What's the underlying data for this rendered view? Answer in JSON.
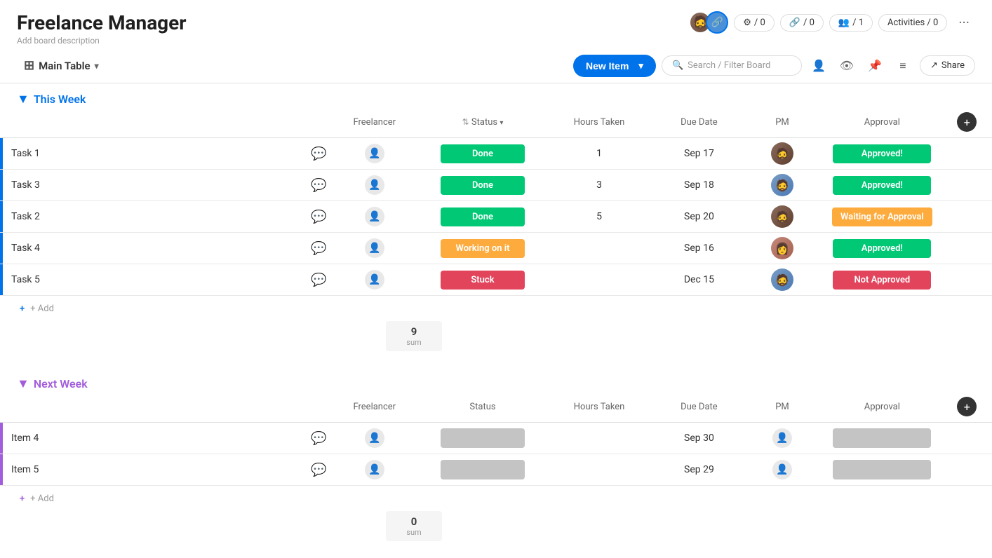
{
  "app": {
    "title": "Freelance Manager",
    "description": "Add board description"
  },
  "header": {
    "activities_label": "Activities / 0",
    "members_label": "/ 1",
    "automation_label": "/ 0",
    "integrations_label": "/ 0"
  },
  "toolbar": {
    "main_table_label": "Main Table",
    "new_item_label": "New Item",
    "search_placeholder": "Search / Filter Board",
    "share_label": "Share"
  },
  "groups": [
    {
      "id": "this-week",
      "title": "This Week",
      "color": "blue",
      "columns": {
        "freelancer": "Freelancer",
        "status": "Status",
        "hours": "Hours Taken",
        "due_date": "Due Date",
        "pm": "PM",
        "approval": "Approval"
      },
      "rows": [
        {
          "id": 1,
          "task": "Task 1",
          "status": "Done",
          "status_type": "done",
          "hours": "1",
          "due_date": "Sep 17",
          "approval": "Approved!",
          "approval_type": "approved"
        },
        {
          "id": 2,
          "task": "Task 3",
          "status": "Done",
          "status_type": "done",
          "hours": "3",
          "due_date": "Sep 18",
          "approval": "Approved!",
          "approval_type": "approved"
        },
        {
          "id": 3,
          "task": "Task 2",
          "status": "Done",
          "status_type": "done",
          "hours": "5",
          "due_date": "Sep 20",
          "approval": "Waiting for Approval",
          "approval_type": "waiting"
        },
        {
          "id": 4,
          "task": "Task 4",
          "status": "Working on it",
          "status_type": "working",
          "hours": "",
          "due_date": "Sep 16",
          "approval": "Approved!",
          "approval_type": "approved"
        },
        {
          "id": 5,
          "task": "Task 5",
          "status": "Stuck",
          "status_type": "stuck",
          "hours": "",
          "due_date": "Dec 15",
          "approval": "Not Approved",
          "approval_type": "not"
        }
      ],
      "sum_value": "9",
      "sum_label": "sum"
    },
    {
      "id": "next-week",
      "title": "Next Week",
      "color": "purple",
      "columns": {
        "freelancer": "Freelancer",
        "status": "Status",
        "hours": "Hours Taken",
        "due_date": "Due Date",
        "pm": "PM",
        "approval": "Approval"
      },
      "rows": [
        {
          "id": 6,
          "task": "Item 4",
          "status": "",
          "status_type": "empty",
          "hours": "",
          "due_date": "Sep 30",
          "approval": "",
          "approval_type": "empty"
        },
        {
          "id": 7,
          "task": "Item 5",
          "status": "",
          "status_type": "empty",
          "hours": "",
          "due_date": "Sep 29",
          "approval": "",
          "approval_type": "empty"
        }
      ],
      "sum_value": "0",
      "sum_label": "sum"
    }
  ],
  "icons": {
    "table": "⊞",
    "chevron_down": "▾",
    "chevron_right": "▸",
    "search": "🔍",
    "comment": "💬",
    "person": "👤",
    "share": "↗",
    "sort": "⇅",
    "filter": "≡",
    "pin": "📌",
    "eye": "👁",
    "dots": "···",
    "plus": "+",
    "circle_blue": "●",
    "circle_purple": "●"
  }
}
